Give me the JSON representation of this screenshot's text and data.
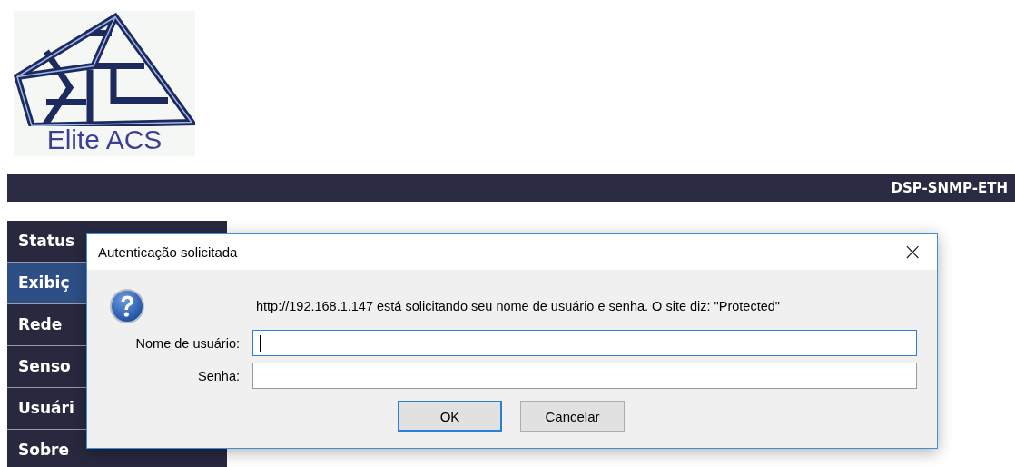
{
  "logo": {
    "text": "Elite ACS"
  },
  "header": {
    "device": "DSP-SNMP-ETH"
  },
  "sidebar": {
    "items": [
      {
        "label": "Status",
        "selected": false
      },
      {
        "label": "Exibiç",
        "selected": true
      },
      {
        "label": "Rede",
        "selected": false
      },
      {
        "label": "Senso",
        "selected": false
      },
      {
        "label": "Usuári",
        "selected": false
      },
      {
        "label": "Sobre",
        "selected": false
      }
    ]
  },
  "dialog": {
    "title": "Autenticação solicitada",
    "close": "×",
    "message": "http://192.168.1.147 está solicitando seu nome de usuário e senha. O site diz: \"Protected\"",
    "fields": [
      {
        "label": "Nome de usuário:",
        "focused": true
      },
      {
        "label": "Senha:",
        "focused": false
      }
    ],
    "buttons": [
      {
        "label": "OK",
        "default": true
      },
      {
        "label": "Cancelar",
        "default": false
      }
    ]
  }
}
